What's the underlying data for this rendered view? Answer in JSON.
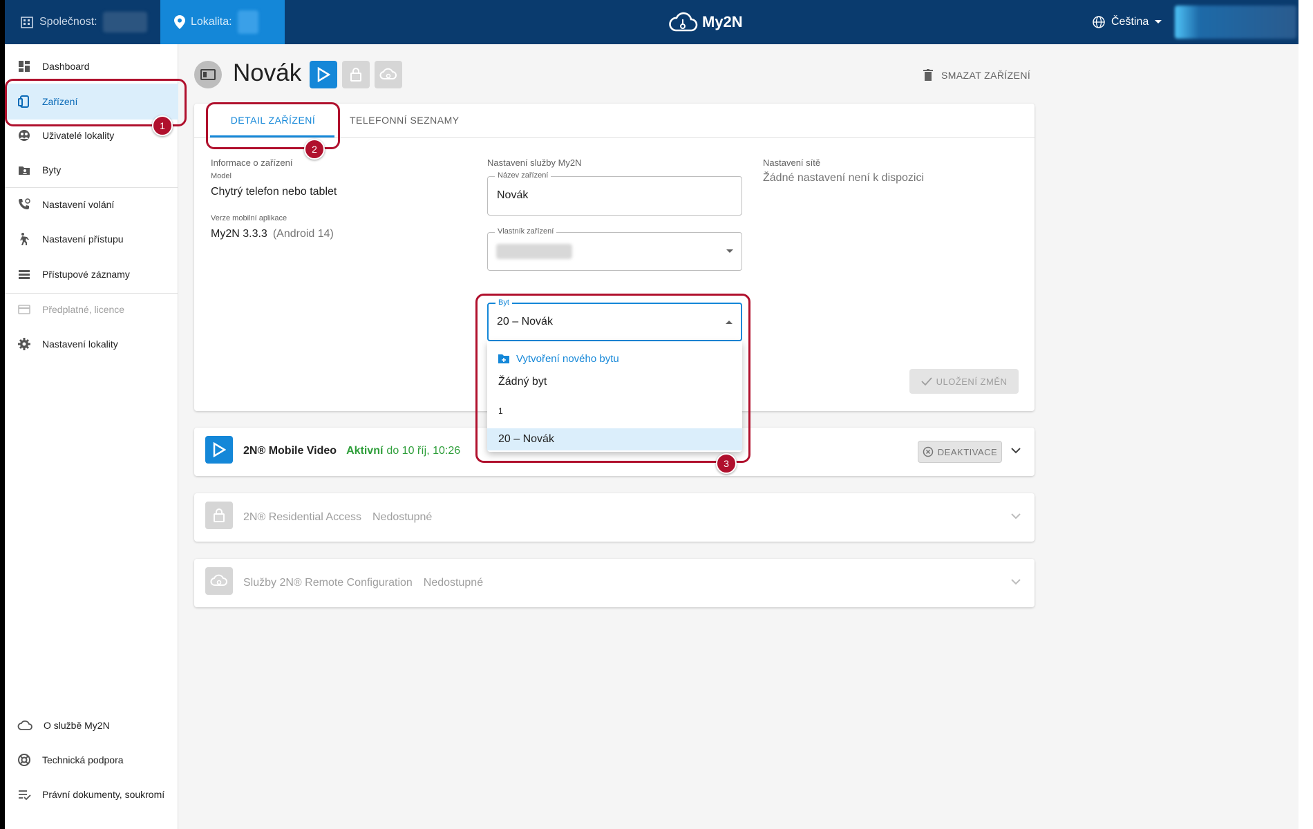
{
  "header": {
    "company_label": "Společnost:",
    "location_label": "Lokalita:",
    "app_name": "My2N",
    "language": "Čeština"
  },
  "sidebar": {
    "items": [
      {
        "label": "Dashboard",
        "icon": "dashboard-icon"
      },
      {
        "label": "Zařízení",
        "icon": "device-icon",
        "active": true
      },
      {
        "label": "Uživatelé lokality",
        "icon": "users-icon"
      },
      {
        "label": "Byty",
        "icon": "apartment-icon"
      },
      {
        "label": "Nastavení volání",
        "icon": "call-settings-icon"
      },
      {
        "label": "Nastavení přístupu",
        "icon": "access-icon"
      },
      {
        "label": "Přístupové záznamy",
        "icon": "access-log-icon"
      },
      {
        "label": "Předplatné, licence",
        "icon": "subscription-icon",
        "disabled": true
      },
      {
        "label": "Nastavení lokality",
        "icon": "gear-icon"
      }
    ],
    "bottom": [
      {
        "label": "O službě My2N",
        "icon": "cloud-icon"
      },
      {
        "label": "Technická podpora",
        "icon": "support-icon"
      },
      {
        "label": "Právní dokumenty, soukromí",
        "icon": "legal-icon"
      }
    ]
  },
  "page": {
    "title": "Novák",
    "delete_label": "SMAZAT ZAŘÍZENÍ"
  },
  "tabs": [
    "DETAIL ZAŘÍZENÍ",
    "TELEFONNÍ SEZNAMY"
  ],
  "info": {
    "heading": "Informace o zařízení",
    "model_label": "Model",
    "model_value": "Chytrý telefon nebo tablet",
    "version_label": "Verze mobilní aplikace",
    "version_value": "My2N 3.3.3",
    "version_extra": "(Android 14)"
  },
  "service": {
    "heading": "Nastavení služby My2N",
    "name_label": "Název zařízení",
    "name_value": "Novák",
    "owner_label": "Vlastník zařízení",
    "apartment_label": "Byt",
    "apartment_value": "20 – Novák"
  },
  "network": {
    "heading": "Nastavení sítě",
    "text": "Žádné nastavení není k dispozici"
  },
  "dropdown": {
    "items": [
      "Vytvoření nového bytu",
      "Žádný byt",
      "1",
      "20 – Novák"
    ]
  },
  "save_label": "ULOŽENÍ ZMĚN",
  "services": [
    {
      "name": "2N® Mobile Video",
      "status": "Aktivní",
      "until": "do 10 říj, 10:26",
      "button": "DEAKTIVACE"
    },
    {
      "name": "2N® Residential Access",
      "status": "Nedostupné"
    },
    {
      "name": "Služby 2N® Remote Configuration",
      "status": "Nedostupné"
    }
  ],
  "annotations": [
    "1",
    "2",
    "3"
  ],
  "colors": {
    "topbar": "#0a3b6e",
    "accent": "#1487d8",
    "annotation": "#b0102d",
    "active_green": "#2e9e3a"
  }
}
